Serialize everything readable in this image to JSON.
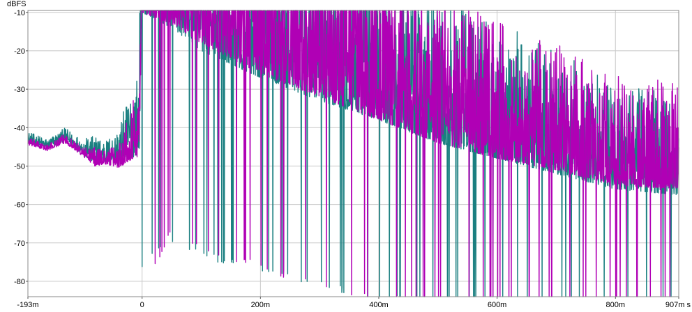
{
  "chart_data": {
    "type": "line",
    "title": "",
    "xlabel": "",
    "ylabel": "dBFS",
    "x_unit": "s",
    "xlim": [
      -0.193,
      0.907
    ],
    "ylim": [
      -84,
      -9.5
    ],
    "grid": true,
    "x_ticks": [
      {
        "value": -0.193,
        "label": "-193m"
      },
      {
        "value": 0,
        "label": "0"
      },
      {
        "value": 0.2,
        "label": "200m"
      },
      {
        "value": 0.4,
        "label": "400m"
      },
      {
        "value": 0.6,
        "label": "600m"
      },
      {
        "value": 0.8,
        "label": "800m"
      },
      {
        "value": 0.907,
        "label": "907m s"
      }
    ],
    "y_ticks": [
      {
        "value": -10,
        "label": "-10"
      },
      {
        "value": -20,
        "label": "-20"
      },
      {
        "value": -30,
        "label": "-30"
      },
      {
        "value": -40,
        "label": "-40"
      },
      {
        "value": -50,
        "label": "-50"
      },
      {
        "value": -60,
        "label": "-60"
      },
      {
        "value": -70,
        "label": "-70"
      },
      {
        "value": -80,
        "label": "-80"
      }
    ],
    "series": [
      {
        "color": "#1a7f80",
        "envelope": [
          {
            "x": -0.193,
            "top": -44,
            "bottom": -47
          },
          {
            "x": -0.16,
            "top": -45.5,
            "bottom": -48
          },
          {
            "x": -0.13,
            "top": -43.5,
            "bottom": -47
          },
          {
            "x": -0.1,
            "top": -47,
            "bottom": -51
          },
          {
            "x": -0.08,
            "top": -49.5,
            "bottom": -57
          },
          {
            "x": -0.06,
            "top": -49,
            "bottom": -55
          },
          {
            "x": -0.04,
            "top": -50,
            "bottom": -60
          },
          {
            "x": -0.02,
            "top": -48,
            "bottom": -66
          },
          {
            "x": -0.005,
            "top": -47,
            "bottom": -69
          },
          {
            "x": 0,
            "top": -10,
            "bottom": -75
          },
          {
            "x": 0.05,
            "top": -14,
            "bottom": -68
          },
          {
            "x": 0.1,
            "top": -20,
            "bottom": -72
          },
          {
            "x": 0.2,
            "top": -27,
            "bottom": -76
          },
          {
            "x": 0.3,
            "top": -33,
            "bottom": -80
          },
          {
            "x": 0.4,
            "top": -38,
            "bottom": -83
          },
          {
            "x": 0.5,
            "top": -44,
            "bottom": -84
          },
          {
            "x": 0.6,
            "top": -48,
            "bottom": -84
          },
          {
            "x": 0.7,
            "top": -52,
            "bottom": -84
          },
          {
            "x": 0.8,
            "top": -56,
            "bottom": -84
          },
          {
            "x": 0.907,
            "top": -57.5,
            "bottom": -84
          }
        ]
      },
      {
        "color": "#b000b5",
        "envelope": [
          {
            "x": -0.193,
            "top": -44.5,
            "bottom": -46.5
          },
          {
            "x": -0.16,
            "top": -46,
            "bottom": -47.5
          },
          {
            "x": -0.13,
            "top": -44,
            "bottom": -46.5
          },
          {
            "x": -0.1,
            "top": -47.5,
            "bottom": -50
          },
          {
            "x": -0.08,
            "top": -50,
            "bottom": -55
          },
          {
            "x": -0.06,
            "top": -49.5,
            "bottom": -53
          },
          {
            "x": -0.04,
            "top": -50.5,
            "bottom": -57
          },
          {
            "x": -0.02,
            "top": -48.5,
            "bottom": -63
          },
          {
            "x": -0.005,
            "top": -47.5,
            "bottom": -66
          },
          {
            "x": 0,
            "top": -10,
            "bottom": -82
          },
          {
            "x": 0.05,
            "top": -13,
            "bottom": -65
          },
          {
            "x": 0.1,
            "top": -18,
            "bottom": -70
          },
          {
            "x": 0.2,
            "top": -26,
            "bottom": -75
          },
          {
            "x": 0.3,
            "top": -32,
            "bottom": -80
          },
          {
            "x": 0.4,
            "top": -38,
            "bottom": -83
          },
          {
            "x": 0.5,
            "top": -44,
            "bottom": -84
          },
          {
            "x": 0.6,
            "top": -48,
            "bottom": -84
          },
          {
            "x": 0.7,
            "top": -51,
            "bottom": -84
          },
          {
            "x": 0.8,
            "top": -55,
            "bottom": -84
          },
          {
            "x": 0.907,
            "top": -56,
            "bottom": -84
          }
        ]
      }
    ]
  }
}
